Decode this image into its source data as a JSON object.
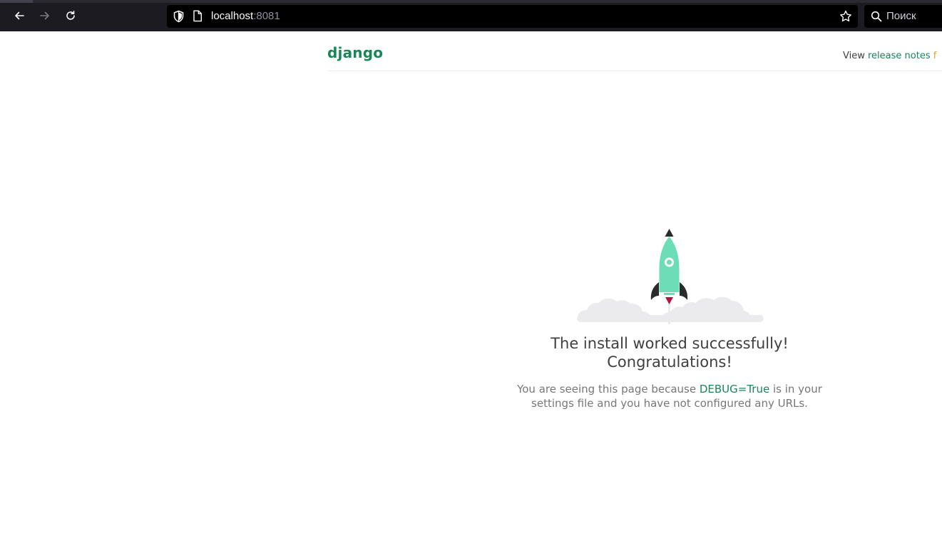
{
  "browser": {
    "url_host": "localhost",
    "url_port": ":8081",
    "search_placeholder": "Поиск",
    "icons": [
      "back-arrow-icon",
      "forward-arrow-icon",
      "reload-icon",
      "shield-icon",
      "page-icon",
      "star-icon",
      "search-icon"
    ]
  },
  "page": {
    "logo": "django",
    "header_prefix": "View",
    "release_notes_link": "release notes",
    "release_notes_tail": "f",
    "title_line1": "The install worked successfully!",
    "title_line2": "Congratulations!",
    "description_before": "You are seeing this page because ",
    "debug_link": "DEBUG=True",
    "description_after": "is in your settings file and you have not configured any URLs."
  },
  "colors": {
    "brand_green": "#188656",
    "rocket_body": "#6dddb8",
    "rocket_dark": "#2b2b2b",
    "flame": "#b5123e",
    "cloud": "#ebebed",
    "toolbar_bg": "#1c1b22"
  }
}
